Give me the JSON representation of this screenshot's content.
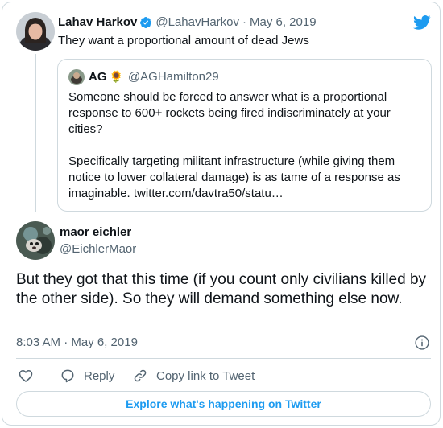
{
  "brand": {
    "logo_icon": "twitter-bird-icon",
    "accent_color": "#1d9bf0"
  },
  "parent_tweet": {
    "name": "Lahav Harkov",
    "verified": true,
    "handle": "@LahavHarkov",
    "separator": "·",
    "date": "May 6, 2019",
    "text": "They want a proportional amount of dead Jews"
  },
  "quoted_tweet": {
    "name": "AG",
    "emoji": "🌻",
    "handle": "@AGHamilton29",
    "paragraphs": [
      "Someone should be forced to answer what is a proportional response to 600+ rockets being fired indiscriminately at your cities?",
      "Specifically targeting militant infrastructure (while giving them notice to lower collateral damage) is as tame of a response as imaginable. twitter.com/davtra50/statu…"
    ]
  },
  "main_tweet": {
    "name": "maor eichler",
    "handle": "@EichlerMaor",
    "text": "But they got that this time (if you count only civilians killed by the other side). So they will demand something else now.",
    "timestamp": "8:03 AM · May 6, 2019"
  },
  "actions": {
    "like_icon": "heart-icon",
    "reply_label": "Reply",
    "copy_label": "Copy link to Tweet"
  },
  "explore_label": "Explore what's happening on Twitter"
}
